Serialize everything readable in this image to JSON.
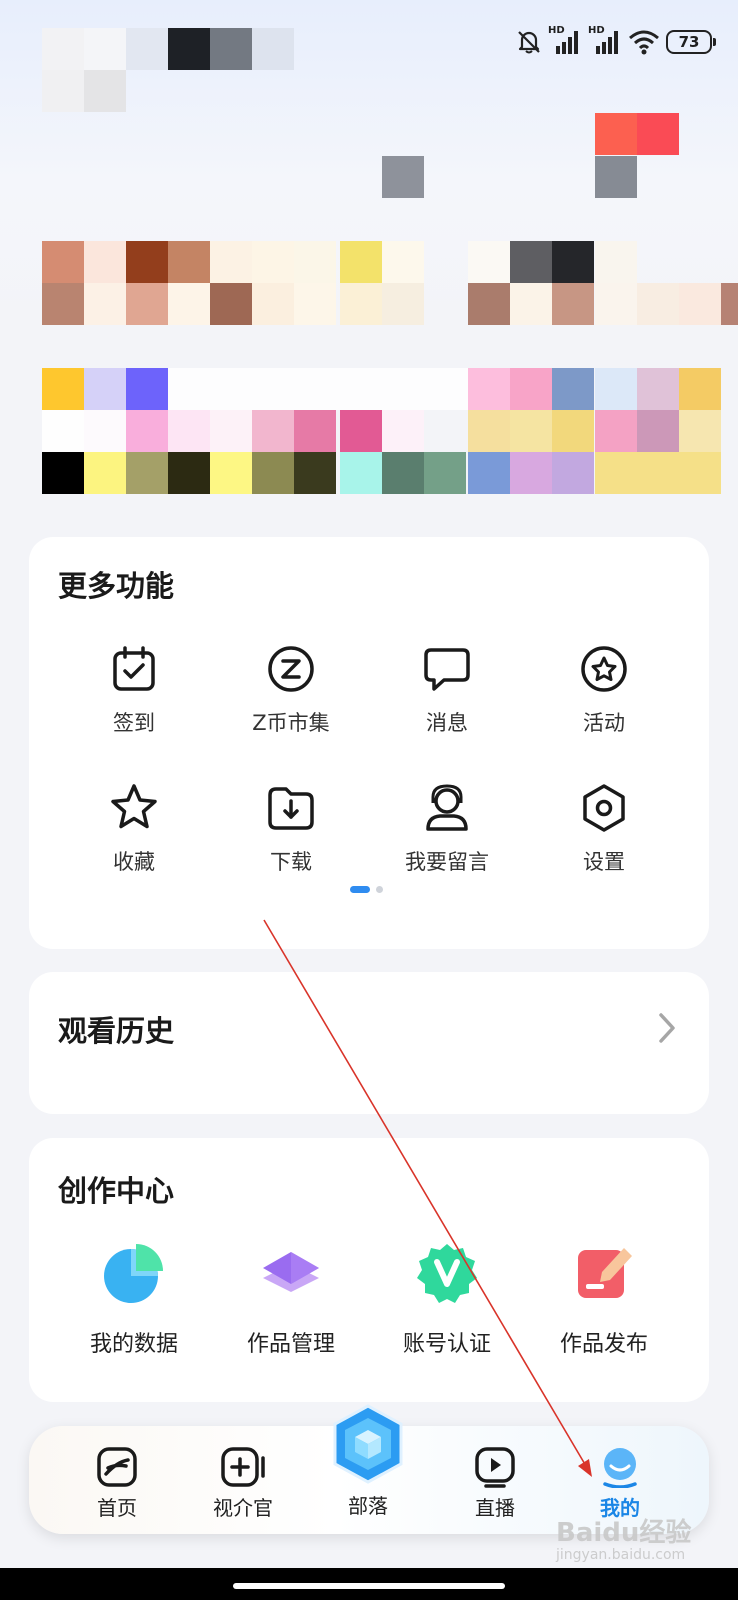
{
  "status_bar": {
    "hd_label": "HD",
    "battery_level": "73"
  },
  "more_features": {
    "title": "更多功能",
    "items": [
      {
        "label": "签到",
        "icon": "calendar-check-icon"
      },
      {
        "label": "Z币市集",
        "icon": "z-coin-icon"
      },
      {
        "label": "消息",
        "icon": "message-icon"
      },
      {
        "label": "活动",
        "icon": "activity-star-icon"
      },
      {
        "label": "收藏",
        "icon": "star-icon"
      },
      {
        "label": "下载",
        "icon": "download-folder-icon"
      },
      {
        "label": "我要留言",
        "icon": "headset-icon"
      },
      {
        "label": "设置",
        "icon": "settings-hexagon-icon"
      }
    ]
  },
  "history": {
    "title": "观看历史"
  },
  "creator_center": {
    "title": "创作中心",
    "items": [
      {
        "label": "我的数据",
        "icon": "pie-chart-icon"
      },
      {
        "label": "作品管理",
        "icon": "layers-icon"
      },
      {
        "label": "账号认证",
        "icon": "verified-badge-icon"
      },
      {
        "label": "作品发布",
        "icon": "publish-edit-icon"
      }
    ]
  },
  "tabbar": {
    "tabs": [
      {
        "label": "首页",
        "icon": "home-icon"
      },
      {
        "label": "视介官",
        "icon": "video-add-icon"
      },
      {
        "label": "部落",
        "icon": "tribe-cube-icon"
      },
      {
        "label": "直播",
        "icon": "live-play-icon"
      },
      {
        "label": "我的",
        "icon": "profile-icon",
        "active": true
      }
    ],
    "active_color": "#1b86e6"
  },
  "watermark": {
    "text": "Baidu经验",
    "url": "jingyan.baidu.com"
  }
}
